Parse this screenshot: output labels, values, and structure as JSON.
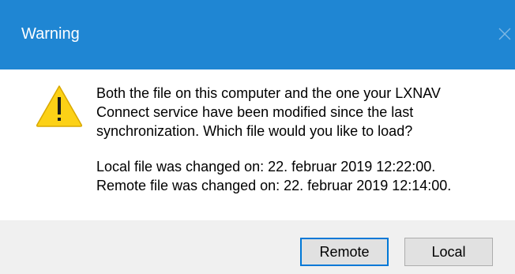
{
  "window": {
    "title": "Warning",
    "title_bar_color": "#1f86d3"
  },
  "icons": {
    "close": "close-icon",
    "warning": "warning-icon"
  },
  "message": {
    "lines": [
      "Both the file on this computer and the one your LXNAV",
      "Connect service have been modified since the last",
      "synchronization. Which file would you like to load?"
    ],
    "local_changed": "Local file was changed on: 22. februar 2019 12:22:00.",
    "remote_changed": "Remote file was changed on: 22. februar 2019 12:14:00."
  },
  "buttons": {
    "remote_label": "Remote",
    "local_label": "Local",
    "default_button": "remote",
    "accent": "#0078d7"
  }
}
